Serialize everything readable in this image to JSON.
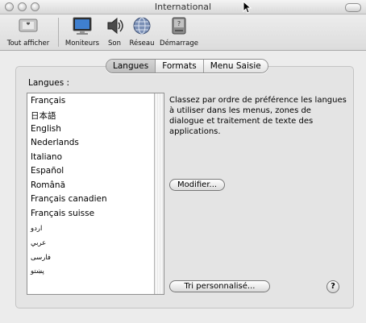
{
  "window": {
    "title": "International"
  },
  "toolbar": {
    "items": [
      {
        "label": "Tout afficher",
        "icon": "show-all-icon"
      },
      {
        "label": "Moniteurs",
        "icon": "displays-icon"
      },
      {
        "label": "Son",
        "icon": "sound-icon"
      },
      {
        "label": "Réseau",
        "icon": "network-icon"
      },
      {
        "label": "Démarrage",
        "icon": "startup-disk-icon"
      }
    ]
  },
  "tabs": [
    {
      "label": "Langues",
      "selected": true
    },
    {
      "label": "Formats",
      "selected": false
    },
    {
      "label": "Menu Saisie",
      "selected": false
    }
  ],
  "languages_panel": {
    "label": "Langues :",
    "items": [
      "Français",
      "日本語",
      "English",
      "Nederlands",
      "Italiano",
      "Español",
      "Română",
      "Français canadien",
      "Français suisse",
      "اردو",
      "عربي",
      "فارسی",
      "پښتو"
    ],
    "description": "Classez par ordre de préférence les langues à utiliser dans les menus, zones de dialogue et traitement de texte des applications.",
    "modify_button": "Modifier...",
    "custom_sort_button": "Tri personnalisé...",
    "help_label": "?"
  }
}
